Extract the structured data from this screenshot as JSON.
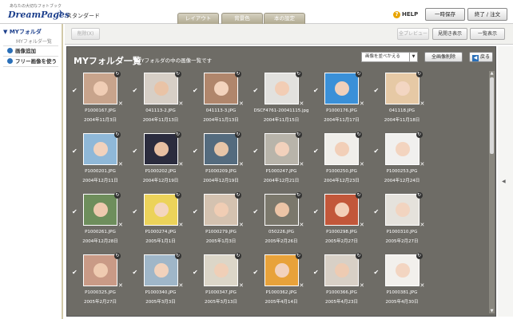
{
  "app": {
    "logo_small": "あなたの大切なフォトブック",
    "logo_text": "DreamPages",
    "plan": "スタンダード"
  },
  "header_tabs": [
    {
      "label": "レイアウト"
    },
    {
      "label": "背景色"
    },
    {
      "label": "本の設定"
    }
  ],
  "header": {
    "help_label": "HELP",
    "save_label": "一時保存",
    "finish_label": "終了 / 注文"
  },
  "sidebar": {
    "title": "MYフォルダ",
    "subtitle": "MYフォルダ一覧",
    "items": [
      {
        "label": "画像追加"
      },
      {
        "label": "フリー画像を使う"
      }
    ]
  },
  "toolbar": {
    "delete_label": "削除(X)",
    "preview_label": "全プレビュー",
    "spread_label": "見開き表示",
    "list_label": "一覧表示"
  },
  "panel": {
    "title": "MYフォルダ一覧",
    "subtitle": "MYフォルダの中の画像一覧です",
    "sort_label": "画像を並べかえる",
    "delete_all_label": "全画像削除",
    "back_label": "戻る"
  },
  "photos": [
    {
      "name": "P1000167.JPG",
      "date": "2004年11月3日",
      "checked": true,
      "bg": "#c8a48c",
      "face": "#f0cdb5"
    },
    {
      "name": "041113-2.JPG",
      "date": "2004年11月13日",
      "checked": true,
      "bg": "#d7cfc6",
      "face": "#e9c3a6"
    },
    {
      "name": "041113-3.JPG",
      "date": "2004年11月13日",
      "checked": true,
      "bg": "#b0866c",
      "face": "#f3d3bd"
    },
    {
      "name": "DSCF4761-20041115.jpg",
      "date": "2004年11月15日",
      "checked": true,
      "bg": "#e2e1de",
      "face": "#f2cdb5"
    },
    {
      "name": "P1000176.JPG",
      "date": "2004年11月17日",
      "checked": true,
      "bg": "#3a90d8",
      "face": "#f0d0bb"
    },
    {
      "name": "041118.JPG",
      "date": "2004年11月18日",
      "checked": true,
      "bg": "#e6c9a5",
      "face": "#f3d6c2"
    },
    {
      "name": "P1000201.JPG",
      "date": "2004年12月11日",
      "checked": true,
      "bg": "#8fb8d8",
      "face": "#f1d2bd"
    },
    {
      "name": "P1000202.JPG",
      "date": "2004年12月19日",
      "checked": true,
      "bg": "#2b2c3e",
      "face": "#e8c0a2"
    },
    {
      "name": "P1000209.JPG",
      "date": "2004年12月19日",
      "checked": true,
      "bg": "#546b7e",
      "face": "#e7c5a8"
    },
    {
      "name": "P1000247.JPG",
      "date": "2004年12月21日",
      "checked": true,
      "bg": "#b8b4aa",
      "face": "#f2d1bc"
    },
    {
      "name": "P1000250.JPG",
      "date": "2004年12月23日",
      "checked": true,
      "bg": "#f0eeea",
      "face": "#f2cfb8"
    },
    {
      "name": "P1000253.JPG",
      "date": "2004年12月24日",
      "checked": true,
      "bg": "#f1f0ee",
      "face": "#f3d4bf"
    },
    {
      "name": "P1000261.JPG",
      "date": "2004年12月28日",
      "checked": true,
      "bg": "#6e8e5c",
      "face": "#eec9ae"
    },
    {
      "name": "P1000274.JPG",
      "date": "2005年1月1日",
      "checked": true,
      "bg": "#ecd35a",
      "face": "#f4d6bf"
    },
    {
      "name": "P1000279.JPG",
      "date": "2005年1月3日",
      "checked": true,
      "bg": "#d4c2b0",
      "face": "#f0cdb4"
    },
    {
      "name": "050226.JPG",
      "date": "2005年2月26日",
      "checked": true,
      "bg": "#7b786c",
      "face": "#ecc4a6"
    },
    {
      "name": "P1000298.JPG",
      "date": "2005年2月27日",
      "checked": true,
      "bg": "#c2573a",
      "face": "#f3d0b9"
    },
    {
      "name": "P1000310.JPG",
      "date": "2005年2月27日",
      "checked": true,
      "bg": "#e5e2dc",
      "face": "#f2d4c0"
    },
    {
      "name": "P1000325.JPG",
      "date": "2005年2月27日",
      "checked": true,
      "bg": "#c99a86",
      "face": "#efcbb1"
    },
    {
      "name": "P1000340.JPG",
      "date": "2005年3月3日",
      "checked": true,
      "bg": "#9fb6c8",
      "face": "#f1d2bc"
    },
    {
      "name": "P1000347.JPG",
      "date": "2005年3月13日",
      "checked": true,
      "bg": "#dcd6c8",
      "face": "#f0cfb7"
    },
    {
      "name": "P1000362.JPG",
      "date": "2005年4月14日",
      "checked": true,
      "bg": "#e8a23a",
      "face": "#f2d2bd"
    },
    {
      "name": "P1000366.JPG",
      "date": "2005年4月23日",
      "checked": true,
      "bg": "#d8d0c6",
      "face": "#eecbb2"
    },
    {
      "name": "P1000381.JPG",
      "date": "2005年4月30日",
      "checked": true,
      "bg": "#f2f0ec",
      "face": "#f3d5c1"
    }
  ]
}
